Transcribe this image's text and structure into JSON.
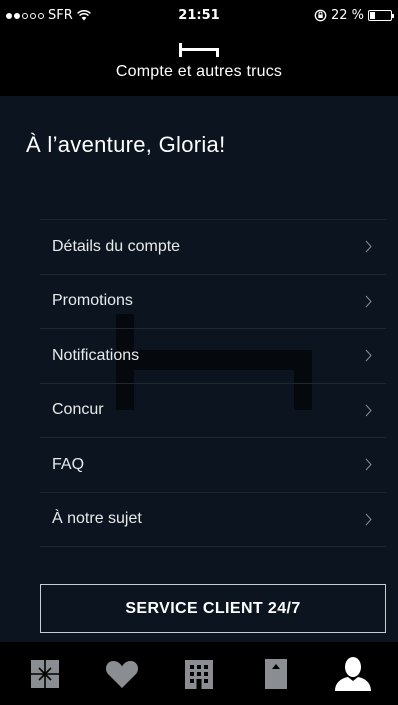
{
  "status_bar": {
    "carrier": "SFR",
    "time": "21:51",
    "battery_percent_label": "22 %",
    "battery_level": 0.22,
    "signal_bars_filled": 2,
    "signal_bars_total": 5
  },
  "header": {
    "title": "Compte et autres trucs",
    "logo_icon": "bed-logo-icon"
  },
  "main": {
    "greeting": "À l’aventure, Gloria!",
    "menu_items": [
      {
        "label": "Détails du compte"
      },
      {
        "label": "Promotions"
      },
      {
        "label": "Notifications"
      },
      {
        "label": "Concur"
      },
      {
        "label": "FAQ"
      },
      {
        "label": "À notre sujet"
      }
    ],
    "service_button_label": "SERVICE CLIENT 24/7"
  },
  "tab_bar": {
    "tabs": [
      {
        "icon": "gift-icon",
        "active": false
      },
      {
        "icon": "heart-icon",
        "active": false
      },
      {
        "icon": "hotel-building-icon",
        "active": false
      },
      {
        "icon": "bookmark-icon",
        "active": false
      },
      {
        "icon": "user-icon",
        "active": true
      }
    ]
  },
  "colors": {
    "background": "#0c151f",
    "bar_background": "#000000",
    "divider": "#1e2833",
    "text": "#ffffff",
    "inactive_tab": "#8a8d91",
    "active_tab": "#ffffff",
    "watermark": "#05080c"
  }
}
